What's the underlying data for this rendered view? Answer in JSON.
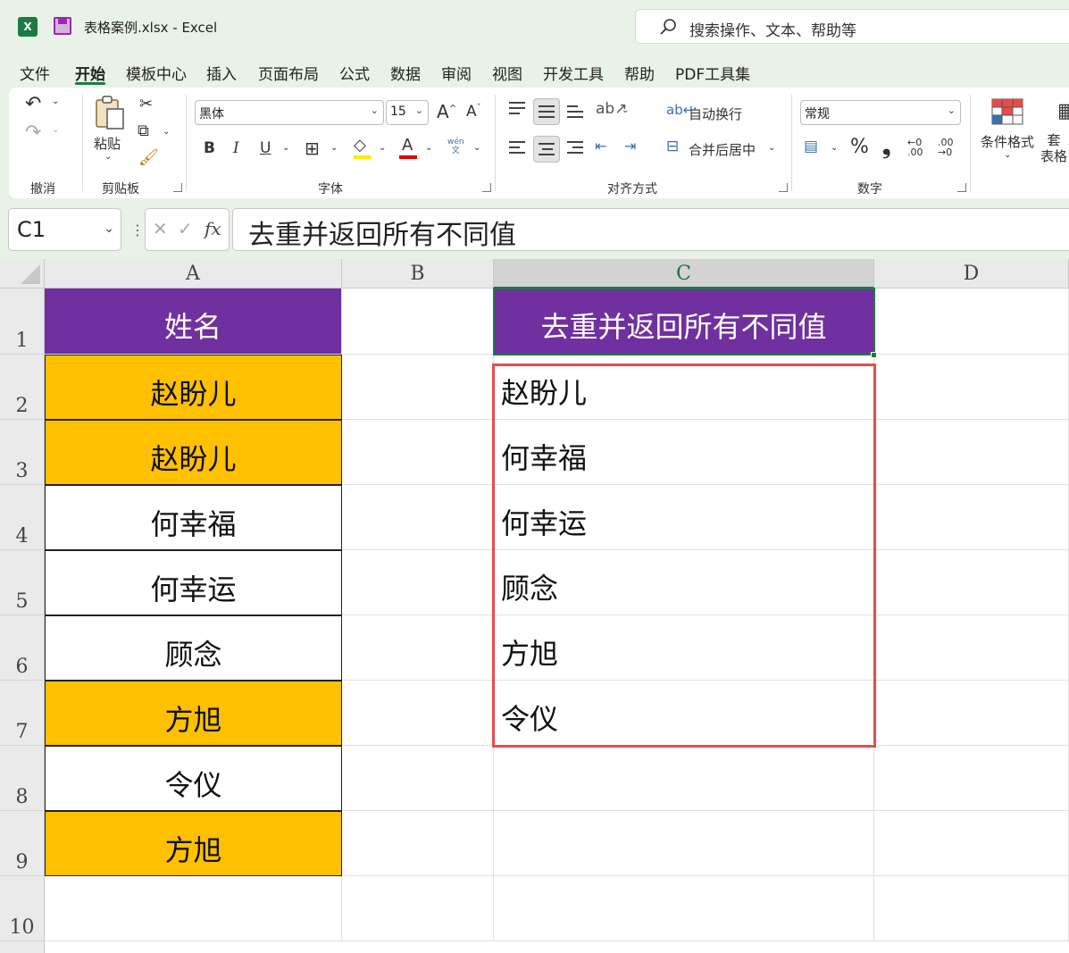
{
  "titlebar": {
    "doc_title": "表格案例.xlsx  -  Excel",
    "search_placeholder": "搜索操作、文本、帮助等"
  },
  "menu": {
    "items": [
      "文件",
      "开始",
      "模板中心",
      "插入",
      "页面布局",
      "公式",
      "数据",
      "审阅",
      "视图",
      "开发工具",
      "帮助",
      "PDF工具集"
    ],
    "active": "开始"
  },
  "ribbon": {
    "groups": {
      "undo": "撤消",
      "clipboard": "剪贴板",
      "font": "字体",
      "alignment": "对齐方式",
      "number": "数字"
    },
    "paste_label": "粘贴",
    "font_name": "黑体",
    "font_size": "15",
    "bold": "B",
    "italic": "I",
    "underline": "U",
    "wrap_text": "自动换行",
    "merge_center": "合并后居中",
    "number_format": "常规",
    "percent": "%",
    "comma": "❟",
    "cond_format": "条件格式",
    "table_format_partial": "套\n表格",
    "wen_label": "wén",
    "wen_sub": "文",
    "font_grow": "A",
    "font_shrink": "A",
    "font_color_letter": "A",
    "inc_decimal": ".00",
    "dec_decimal": ".00",
    "colors": {
      "highlight": "#ffee00",
      "font_color": "#e00000",
      "excel_green": "#1d7a44",
      "purple_header": "#7030a0",
      "orange_fill": "#ffc000",
      "red_box": "#e84b4b"
    }
  },
  "formula_bar": {
    "name_box": "C1",
    "formula": "去重并返回所有不同值",
    "fx": "fx"
  },
  "grid": {
    "columns": [
      "A",
      "B",
      "C",
      "D"
    ],
    "selected_column": "C",
    "rows": [
      "1",
      "2",
      "3",
      "4",
      "5",
      "6",
      "7",
      "8",
      "9",
      "10"
    ],
    "column_a": {
      "header": "姓名",
      "values": [
        "赵盼儿",
        "赵盼儿",
        "何幸福",
        "何幸运",
        "顾念",
        "方旭",
        "令仪",
        "方旭"
      ],
      "fills": [
        "orange",
        "orange",
        "white",
        "white",
        "white",
        "orange",
        "white",
        "orange"
      ]
    },
    "column_c": {
      "header": "去重并返回所有不同值",
      "values": [
        "赵盼儿",
        "何幸福",
        "何幸运",
        "顾念",
        "方旭",
        "令仪"
      ]
    }
  }
}
